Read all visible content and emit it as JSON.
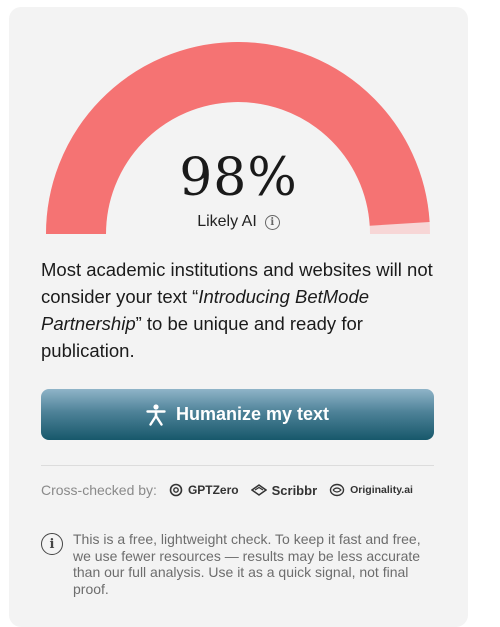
{
  "score": {
    "percent_label": "98%",
    "percent_value": 98,
    "verdict": "Likely AI",
    "info_icon": "info-icon",
    "gauge_fill_color": "#f57373",
    "gauge_track_color": "#f7d6d6"
  },
  "message": {
    "before": "Most academic institutions and websites will not consider your text “",
    "title": "Introducing BetMode Partnership",
    "after": "” to be unique and ready for publication."
  },
  "cta": {
    "label": "Humanize my text",
    "icon": "person-icon",
    "color": "#17586b"
  },
  "crosscheck": {
    "label": "Cross-checked by:",
    "brands": [
      "GPTZero",
      "Scribbr",
      "Originality.ai"
    ]
  },
  "note": {
    "icon": "info-icon",
    "text": "This is a free, lightweight check. To keep it fast and free, we use fewer resources — results may be less accurate than our full analysis. Use it as a quick signal, not final proof."
  }
}
